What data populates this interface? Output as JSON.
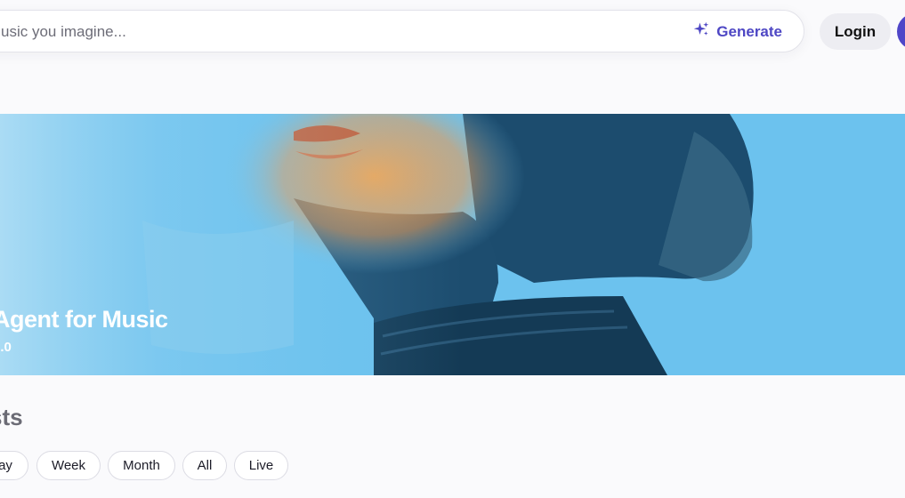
{
  "search": {
    "placeholder": "usic you imagine...",
    "generate_label": "Generate"
  },
  "header": {
    "login_label": "Login"
  },
  "banner": {
    "title": "Agent for Music",
    "subtitle": "2.0"
  },
  "section": {
    "title": "sts"
  },
  "filters": [
    {
      "label": "ay"
    },
    {
      "label": "Week"
    },
    {
      "label": "Month"
    },
    {
      "label": "All"
    },
    {
      "label": "Live"
    }
  ],
  "colors": {
    "accent": "#4e47c4",
    "avatar": "#4f46c8",
    "banner_bg": "#6dc3ee",
    "page_bg": "#fafafc"
  },
  "icons": {
    "generate": "sparkle-icon"
  }
}
